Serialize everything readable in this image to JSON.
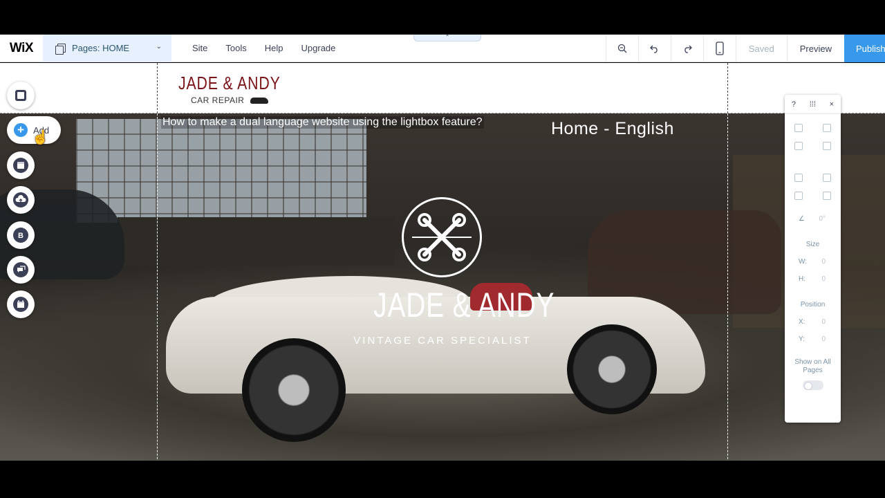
{
  "app": {
    "logo": "WiX"
  },
  "topbar": {
    "pages_label": "Pages: HOME",
    "chevron": "⌄",
    "menu": [
      "Site",
      "Tools",
      "Help",
      "Upgrade"
    ],
    "collapse": "⌃",
    "zoom_icon": "zoom-out-icon",
    "undo_icon": "undo-icon",
    "redo_icon": "redo-icon",
    "mobile_icon": "mobile-icon",
    "saved_label": "Saved",
    "preview_label": "Preview",
    "publish_label": "Publish",
    "publish_color": "#3899ec"
  },
  "site": {
    "brand_name": "JADE & ANDY",
    "brand_sub": "CAR REPAIR",
    "brand_color": "#7a1419",
    "hero_title": "JADE & ANDY",
    "hero_subtitle": "VINTAGE CAR SPECIALIST",
    "overlay_question": "How to make a dual language website using the lightbox feature?",
    "language_title": "Home - English"
  },
  "left_tools": {
    "add_label": "Add",
    "items": [
      "background-icon",
      "add-icon",
      "app-market-icon",
      "upload-icon",
      "blog-icon",
      "chat-icon",
      "bookings-icon"
    ]
  },
  "inspector": {
    "help": "?",
    "close": "×",
    "angle_value": "0°",
    "size_label": "Size",
    "w_label": "W:",
    "w_value": "0",
    "h_label": "H:",
    "h_value": "0",
    "position_label": "Position",
    "x_label": "X:",
    "x_value": "0",
    "y_label": "Y:",
    "y_value": "0",
    "show_all_label": "Show on All Pages"
  }
}
